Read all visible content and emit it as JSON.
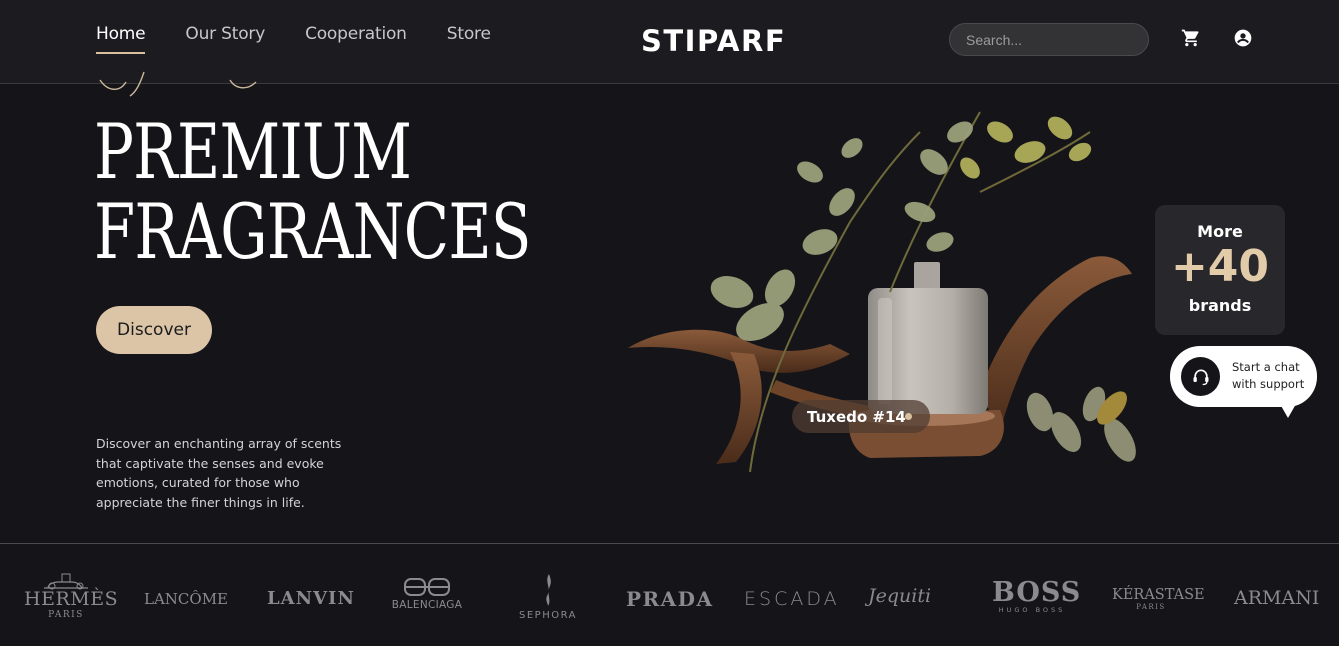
{
  "header": {
    "nav": [
      {
        "label": "Home",
        "active": true
      },
      {
        "label": "Our Story",
        "active": false
      },
      {
        "label": "Cooperation",
        "active": false
      },
      {
        "label": "Store",
        "active": false
      }
    ],
    "logo": "STIPARF",
    "search_placeholder": "Search...",
    "cart_icon": "cart-icon",
    "account_icon": "account-icon"
  },
  "hero": {
    "title_line1": "PREMIUM",
    "title_line2": "FRAGRANCES",
    "cta_label": "Discover",
    "description": "Discover an enchanting array of scents that captivate the senses and evoke emotions, curated for those who appreciate the finer things in life."
  },
  "product": {
    "tag_label": "Tuxedo #14"
  },
  "brands_card": {
    "more": "More",
    "count": "+40",
    "label": "brands"
  },
  "chat": {
    "text_line1": "Start a chat",
    "text_line2": "with support",
    "icon": "headset-icon"
  },
  "brands": [
    {
      "name": "HERMÈS",
      "sub": "PARIS"
    },
    {
      "name": "LANCÔME",
      "sub": ""
    },
    {
      "name": "LANVIN",
      "sub": ""
    },
    {
      "name": "BALENCIAGA",
      "sub": ""
    },
    {
      "name": "SEPHORA",
      "sub": ""
    },
    {
      "name": "PRADA",
      "sub": ""
    },
    {
      "name": "ESCADA",
      "sub": ""
    },
    {
      "name": "Jequiti",
      "sub": ""
    },
    {
      "name": "BOSS",
      "sub": "HUGO BOSS"
    },
    {
      "name": "KÉRASTASE",
      "sub": "PARIS"
    },
    {
      "name": "ARMANI",
      "sub": ""
    }
  ],
  "colors": {
    "background": "#151419",
    "header": "#1c1b1f",
    "accent": "#dcc5a7",
    "count_accent": "#e1cba9"
  }
}
